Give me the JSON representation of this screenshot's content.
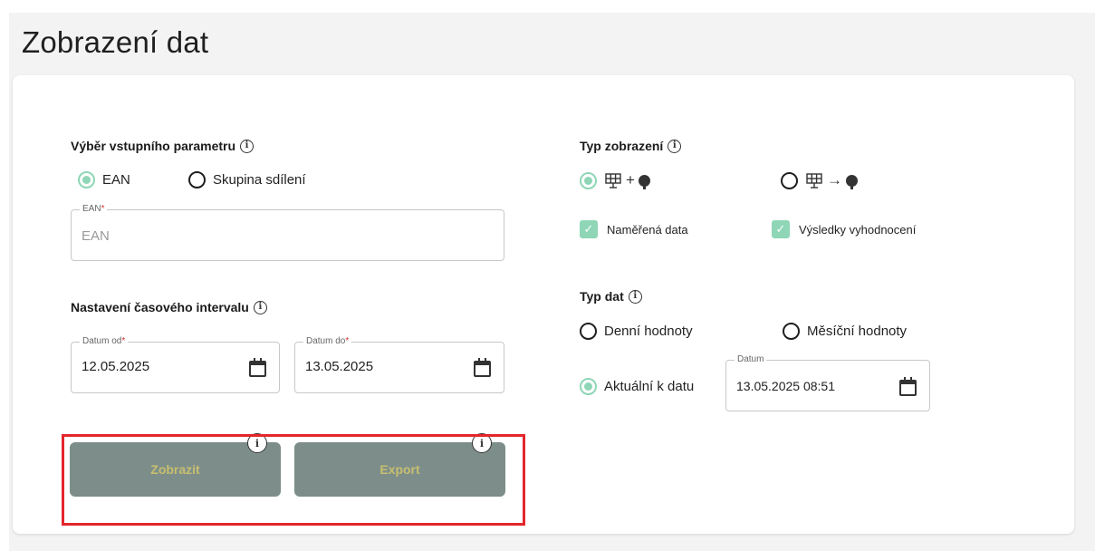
{
  "page": {
    "title": "Zobrazení dat"
  },
  "input_param": {
    "label": "Výběr vstupního parametru",
    "options": [
      {
        "label": "EAN",
        "selected": true
      },
      {
        "label": "Skupina sdílení",
        "selected": false
      }
    ],
    "ean_field": {
      "legend": "EAN",
      "required_mark": "*",
      "placeholder": "EAN",
      "value": ""
    }
  },
  "time_interval": {
    "label": "Nastavení časového intervalu",
    "date_from": {
      "legend": "Datum od",
      "required_mark": "*",
      "value": "12.05.2025"
    },
    "date_to": {
      "legend": "Datum do",
      "required_mark": "*",
      "value": "13.05.2025"
    }
  },
  "display_type": {
    "label": "Typ zobrazení",
    "modes": [
      {
        "icon": "solar-plus-bulb-icon",
        "selected": true
      },
      {
        "icon": "solar-arrow-bulb-icon",
        "selected": false
      }
    ],
    "checkboxes": [
      {
        "label": "Naměřená data",
        "checked": true
      },
      {
        "label": "Výsledky vyhodnocení",
        "checked": true
      }
    ]
  },
  "data_type": {
    "label": "Typ dat",
    "options": [
      {
        "label": "Denní hodnoty",
        "selected": false
      },
      {
        "label": "Měsíční hodnoty",
        "selected": false
      },
      {
        "label": "Aktuální k datu",
        "selected": true
      }
    ],
    "date_field": {
      "legend": "Datum",
      "value": "13.05.2025 08:51"
    }
  },
  "buttons": {
    "show": "Zobrazit",
    "export": "Export"
  },
  "colors": {
    "accent": "#8fd6b6",
    "button_bg": "#7d8e8a",
    "button_text": "#c7be6f",
    "highlight": "#e3262c"
  }
}
